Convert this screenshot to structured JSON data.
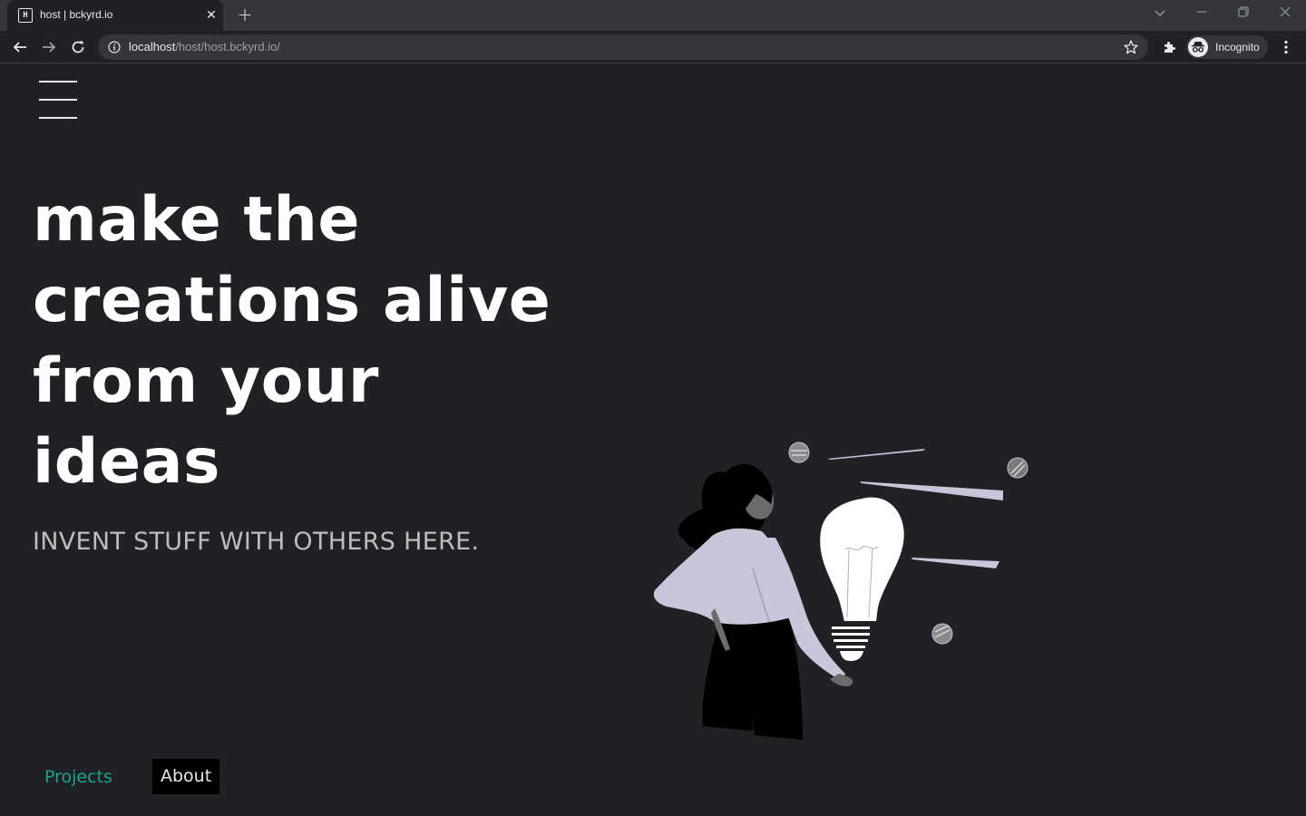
{
  "browser": {
    "tab_title": "host | bckyrd.io",
    "tab_favicon_text": "H",
    "url_host": "localhost",
    "url_path": "/host/host.bckyrd.io/",
    "profile_label": "Incognito"
  },
  "hero": {
    "heading_lines": [
      "make the",
      "creations alive",
      "from your",
      "ideas"
    ],
    "subheading": "INVENT STUFF WITH OTHERS HERE."
  },
  "nav": {
    "projects_label": "Projects",
    "about_label": "About"
  },
  "colors": {
    "page_background": "#202124",
    "heading": "#ffffff",
    "subheading": "#bdbdbd",
    "projects_link": "#17a589",
    "about_button_bg": "#000000",
    "illustration_accent": "#c9c6dc"
  },
  "icons": {
    "menu": "hamburger-menu-icon",
    "illustration": "woman-holding-lightbulb-illustration"
  }
}
